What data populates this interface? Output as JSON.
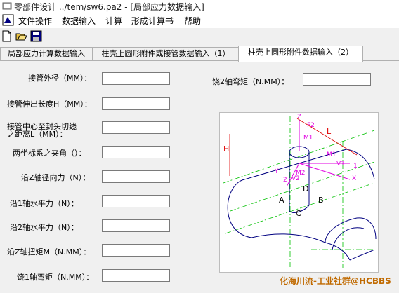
{
  "window": {
    "title": "零部件设计 ../tem/sw6.pa2 - [局部应力数据输入]"
  },
  "menu": [
    "文件操作",
    "数据输入",
    "计算",
    "形成计算书",
    "帮助"
  ],
  "toolbar": {
    "icons": [
      "new-file-icon",
      "open-folder-icon",
      "save-disk-icon"
    ]
  },
  "tabs": [
    {
      "label": "局部应力计算数据输入",
      "active": false
    },
    {
      "label": "柱壳上圆形附件或接管数据输入（1）",
      "active": false
    },
    {
      "label": "柱壳上圆形附件数据输入（2）",
      "active": true
    }
  ],
  "form": {
    "left": [
      {
        "label": "接管外径（MM）：",
        "value": ""
      },
      {
        "label": "接管伸出长度H（MM）：",
        "value": ""
      },
      {
        "label1": "接管中心至封头切线",
        "label2": "之距离L（MM）：",
        "value": ""
      },
      {
        "label": "两坐标系之夹角（）：",
        "value": ""
      },
      {
        "label": "沿Z轴径向力（N）：",
        "value": ""
      },
      {
        "label": "沿1轴水平力（N）：",
        "value": ""
      },
      {
        "label": "沿2轴水平力（N）：",
        "value": ""
      },
      {
        "label": "沿Z轴扭矩M（N.MM）：",
        "value": ""
      },
      {
        "label": "饶1轴弯矩（N.MM）：",
        "value": ""
      }
    ],
    "right": [
      {
        "label": "饶2轴弯矩（N.MM）：",
        "value": ""
      }
    ]
  },
  "diagram": {
    "labels": {
      "H": "H",
      "L": "L",
      "Z": "Z",
      "F2": "F2",
      "M1_top": "M1",
      "M1": "M1",
      "V1": "V1",
      "one": "1",
      "X": "X",
      "Y": "Y",
      "two": "2",
      "M2": "M2",
      "V2": "V2",
      "A": "A",
      "B": "B",
      "C": "C",
      "D": "D"
    },
    "colors": {
      "line": "#000080",
      "guide": "#00c000",
      "force": "#e000e0",
      "dim": "#e00000"
    }
  },
  "watermark": "化海川流-工业社群@HCBBS"
}
